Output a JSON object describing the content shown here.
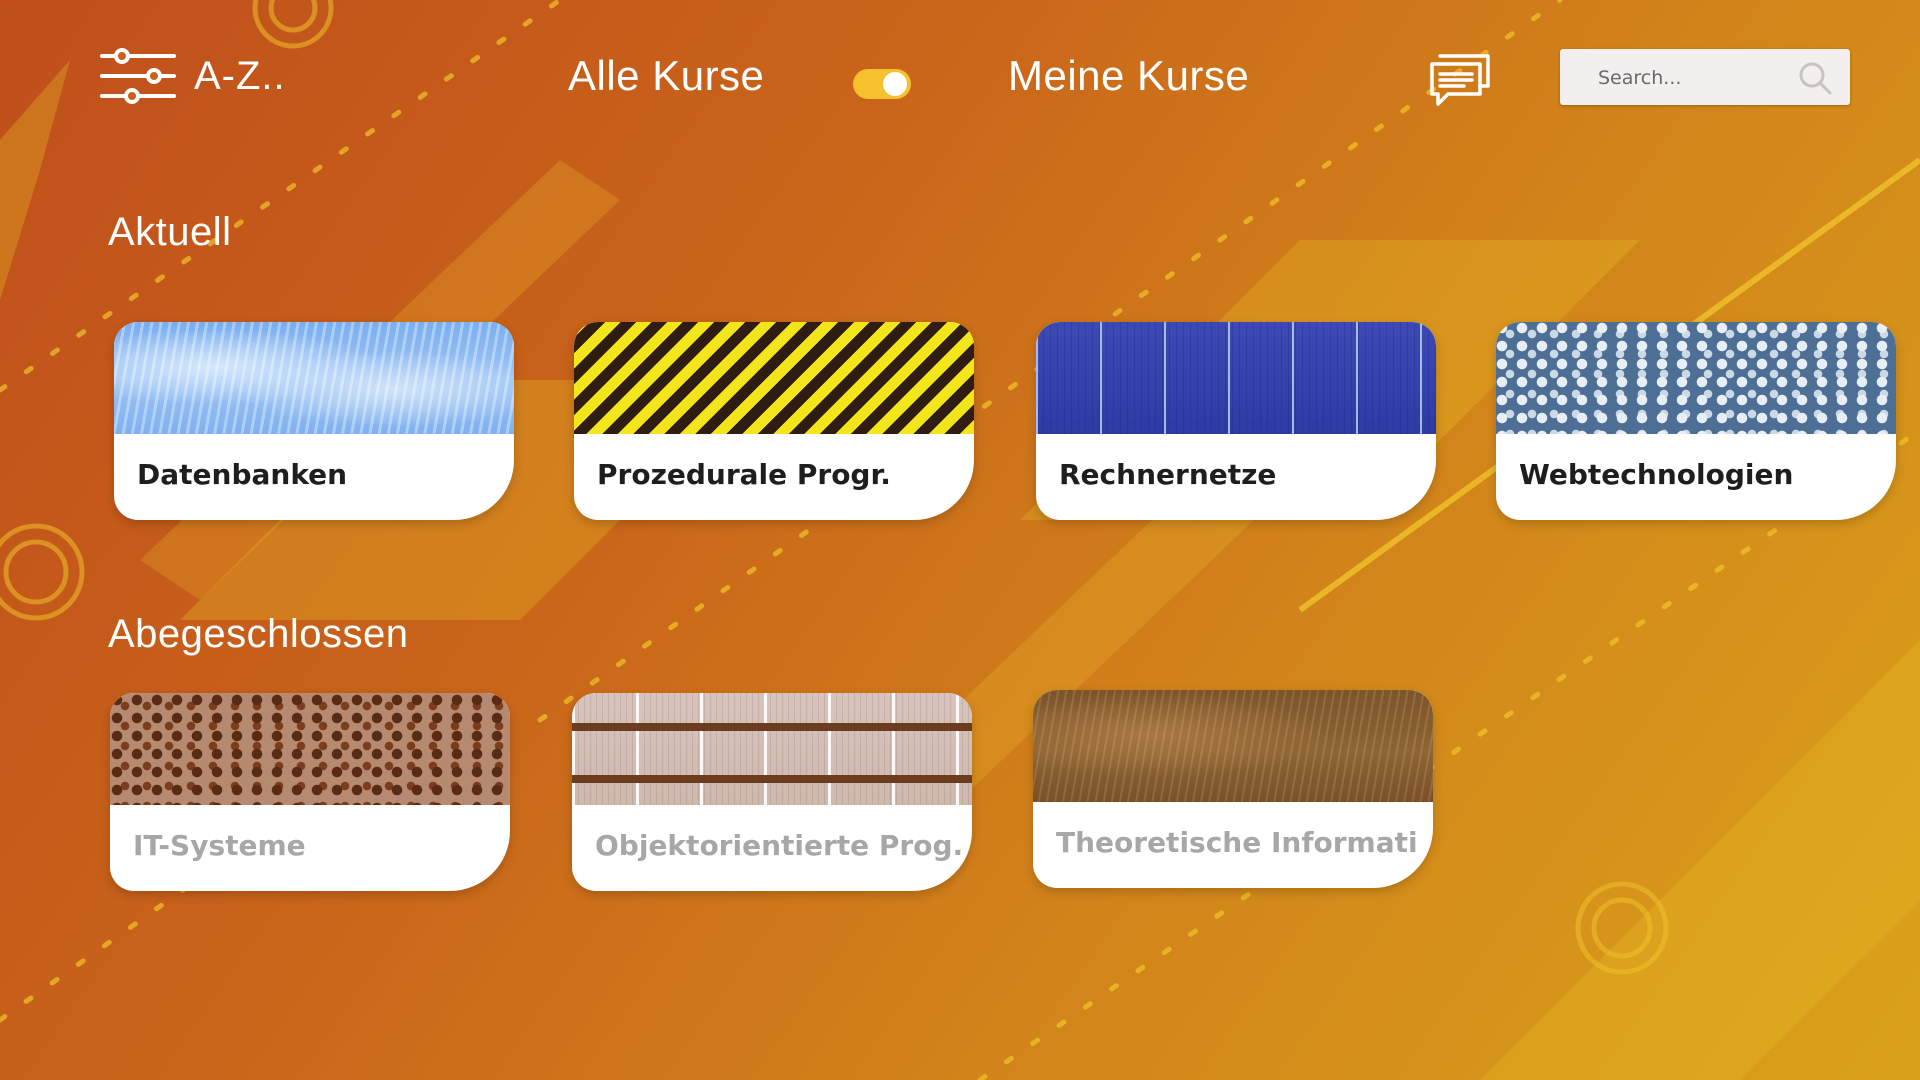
{
  "header": {
    "filter_label": "A-Z..",
    "tab_all_label": "Alle Kurse",
    "tab_mine_label": "Meine Kurse",
    "toggle_on": true,
    "search_placeholder": "Search..."
  },
  "sections": {
    "current": {
      "title": "Aktuell",
      "courses": [
        {
          "label": "Datenbanken",
          "pattern": "ice"
        },
        {
          "label": "Prozedurale Progr.",
          "pattern": "hazard"
        },
        {
          "label": "Rechnernetze",
          "pattern": "bluewood"
        },
        {
          "label": "Webtechnologien",
          "pattern": "leopard-blue"
        }
      ]
    },
    "done": {
      "title": "Abegeschlossen",
      "courses": [
        {
          "label": "IT-Systeme",
          "pattern": "leopard-brown"
        },
        {
          "label": "Objektorientierte Prog.",
          "pattern": "beigewood"
        },
        {
          "label": "Theoretische Informati",
          "pattern": "brownwood"
        }
      ]
    }
  },
  "colors": {
    "background_start": "#c04f1b",
    "background_end": "#daa21a",
    "toggle_accent": "#f5c12c",
    "card_text": "#1e1e1e",
    "card_text_done": "#a7a7a7"
  },
  "icons": {
    "filter": "sliders-icon",
    "chat": "chat-bubbles-icon",
    "search": "search-icon"
  }
}
